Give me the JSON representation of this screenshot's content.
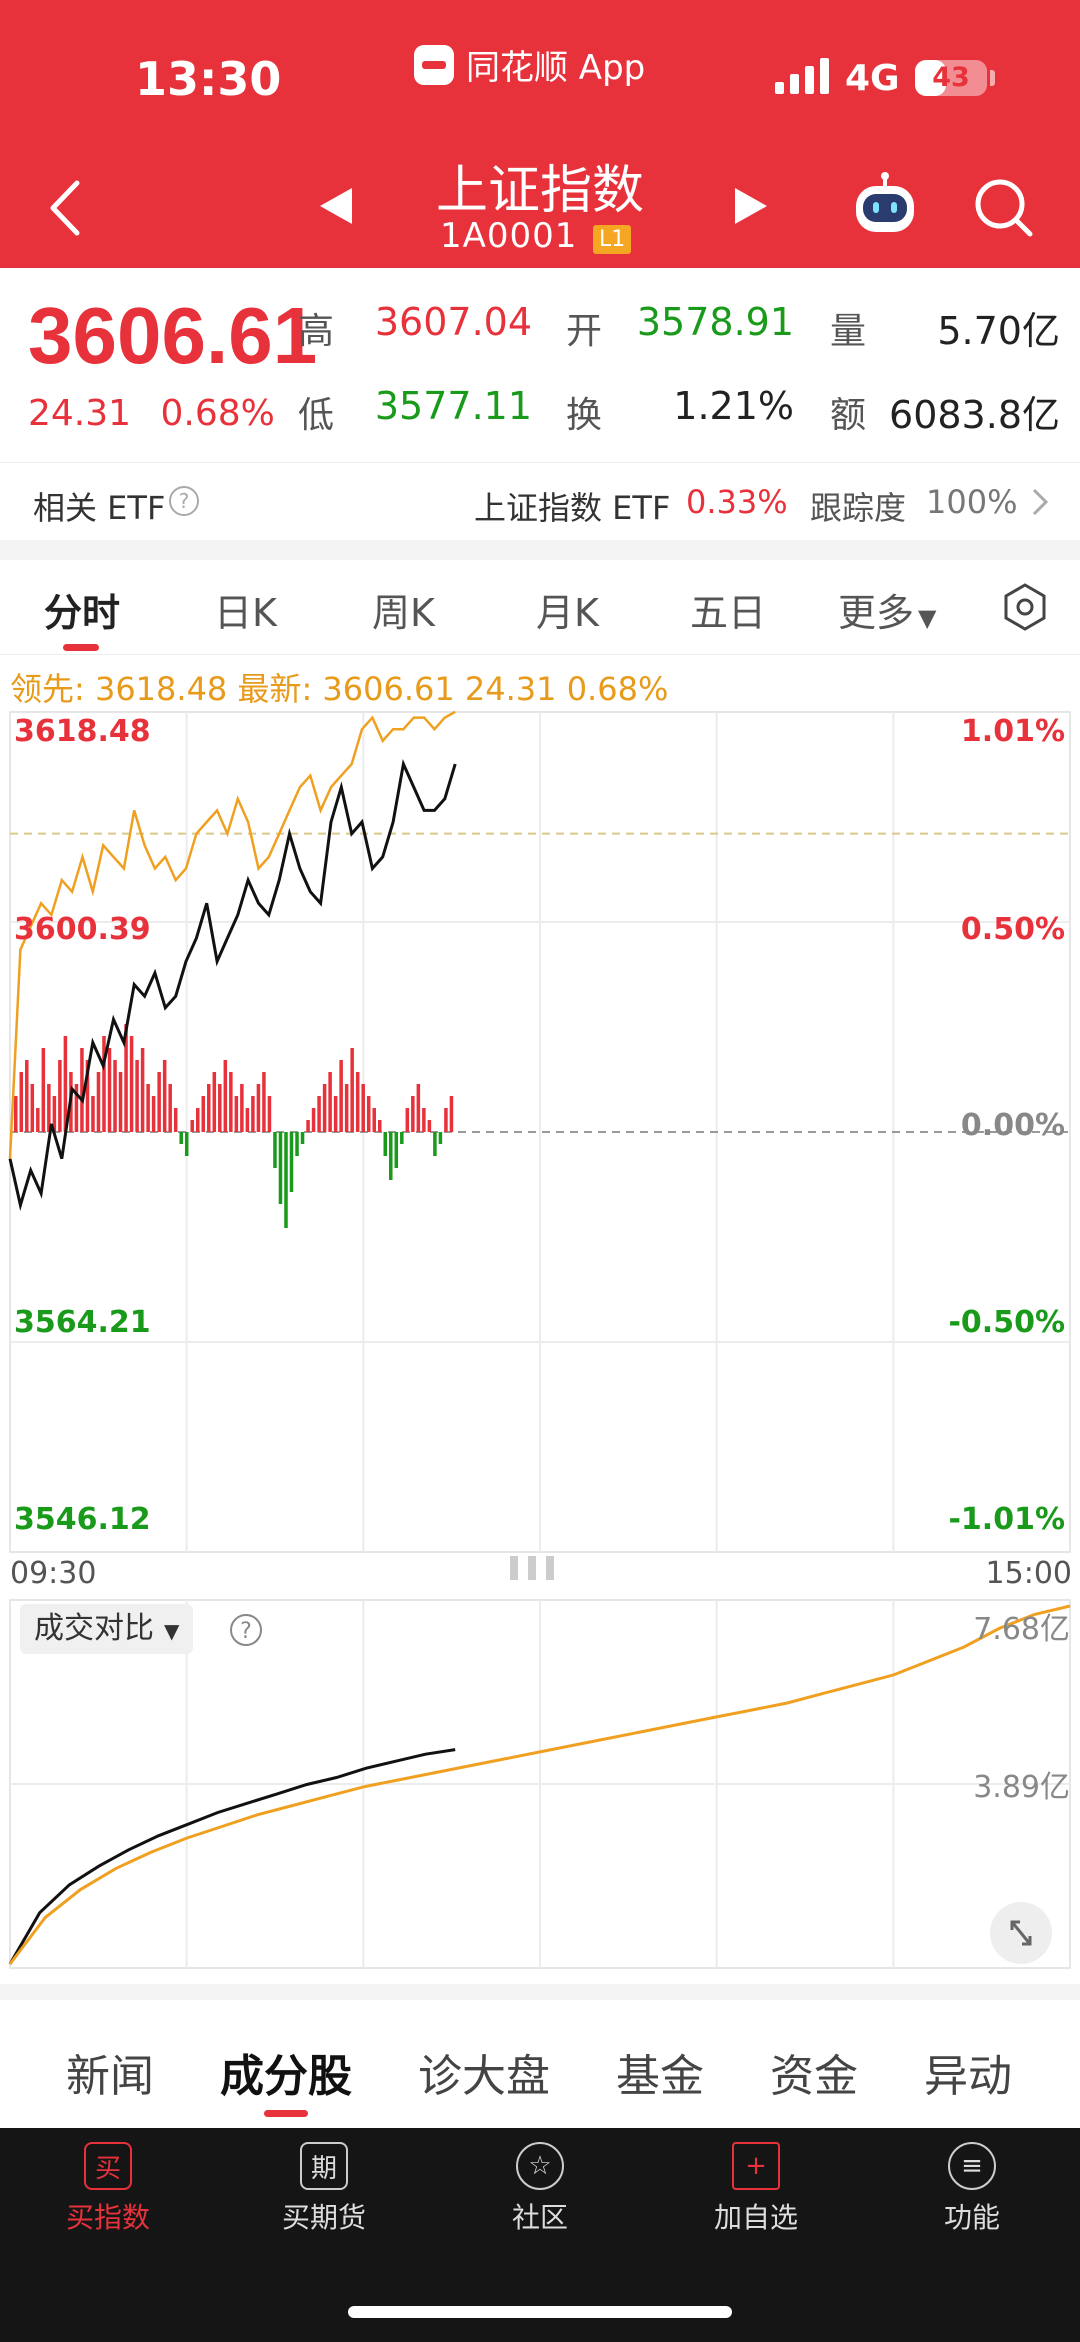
{
  "status": {
    "time": "13:30",
    "app": "同花顺 App",
    "network": "4G",
    "battery": "43",
    "battery_level": 0.43
  },
  "nav": {
    "title": "上证指数",
    "code": "1A0001",
    "tag": "L1"
  },
  "quote": {
    "price": "3606.61",
    "change": "24.31",
    "change_pct": "0.68%",
    "high_label": "高",
    "high": "3607.04",
    "open_label": "开",
    "open": "3578.91",
    "volume_label": "量",
    "volume": "5.70亿",
    "low_label": "低",
    "low": "3577.11",
    "turnover_label": "换",
    "turnover": "1.21%",
    "amount_label": "额",
    "amount": "6083.8亿"
  },
  "etf": {
    "label": "相关 ETF",
    "name": "上证指数 ETF",
    "pct": "0.33%",
    "tracking_label": "跟踪度",
    "tracking": "100%"
  },
  "chart_tabs": [
    {
      "label": "分时"
    },
    {
      "label": "日K"
    },
    {
      "label": "周K"
    },
    {
      "label": "月K"
    },
    {
      "label": "五日"
    },
    {
      "label": "更多"
    }
  ],
  "chart_info": "领先: 3618.48  最新: 3606.61  24.31  0.68%",
  "chart_data": {
    "type": "line",
    "ylim": [
      3546.12,
      3618.48
    ],
    "y_labels_left": [
      "3618.48",
      "3600.39",
      "3564.21",
      "3546.12"
    ],
    "y_labels_right": [
      "1.01%",
      "0.50%",
      "0.00%",
      "-0.50%",
      "-1.01%"
    ],
    "x_labels": [
      "09:30",
      "15:00"
    ],
    "series": [
      {
        "color": "#111111",
        "values": [
          3580,
          3576,
          3579,
          3577,
          3583,
          3580,
          3586,
          3585,
          3590,
          3588,
          3592,
          3590,
          3595,
          3594,
          3596,
          3593,
          3594,
          3597,
          3599,
          3602,
          3597,
          3599,
          3601,
          3604,
          3602,
          3601,
          3604,
          3608,
          3605,
          3603,
          3602,
          3609,
          3612,
          3608,
          3609,
          3605,
          3606,
          3609,
          3614,
          3612,
          3610,
          3610,
          3611,
          3614
        ]
      },
      {
        "color": "#f0a020",
        "values": [
          3580,
          3598,
          3600,
          3602,
          3601,
          3604,
          3603,
          3606,
          3603,
          3607,
          3606,
          3605,
          3610,
          3607,
          3605,
          3606,
          3604,
          3605,
          3608,
          3609,
          3610,
          3608,
          3611,
          3609,
          3605,
          3606,
          3608,
          3610,
          3612,
          3613,
          3610,
          3612,
          3613,
          3614,
          3617,
          3618,
          3616,
          3617,
          3617,
          3618,
          3618,
          3617,
          3618,
          3618.5
        ]
      }
    ],
    "volume_bars": [
      3,
      5,
      6,
      4,
      2,
      7,
      4,
      3,
      6,
      8,
      5,
      4,
      7,
      6,
      3,
      5,
      8,
      7,
      6,
      5,
      9,
      8,
      6,
      7,
      4,
      3,
      5,
      6,
      4,
      2,
      -1,
      -2,
      1,
      2,
      3,
      4,
      5,
      4,
      6,
      5,
      3,
      4,
      2,
      3,
      4,
      5,
      3,
      -3,
      -6,
      -8,
      -5,
      -2,
      -1,
      1,
      2,
      3,
      4,
      5,
      3,
      6,
      4,
      7,
      5,
      4,
      3,
      2,
      1,
      -2,
      -4,
      -3,
      -1,
      2,
      3,
      4,
      2,
      1,
      -2,
      -1,
      2,
      3
    ],
    "cumulative": {
      "y_labels": [
        "7.68亿",
        "3.89亿"
      ],
      "series": [
        {
          "color": "#111111",
          "values": [
            0,
            1.1,
            1.7,
            2.1,
            2.45,
            2.75,
            3.0,
            3.25,
            3.45,
            3.65,
            3.85,
            4.0,
            4.2,
            4.35,
            4.5,
            4.6
          ]
        },
        {
          "color": "#f0a020",
          "values": [
            0,
            1.0,
            1.6,
            2.05,
            2.4,
            2.7,
            2.95,
            3.2,
            3.4,
            3.6,
            3.8,
            3.95,
            4.1,
            4.25,
            4.4,
            4.55,
            4.7,
            4.85,
            5.0,
            5.15,
            5.3,
            5.45,
            5.6,
            5.8,
            6.0,
            6.2,
            6.5,
            6.8,
            7.2,
            7.5,
            7.68
          ]
        }
      ]
    }
  },
  "volume_panel": {
    "label": "成交对比"
  },
  "bottom_tabs": [
    {
      "label": "新闻"
    },
    {
      "label": "成分股"
    },
    {
      "label": "诊大盘"
    },
    {
      "label": "基金"
    },
    {
      "label": "资金"
    },
    {
      "label": "异动"
    }
  ],
  "bottom_nav": [
    {
      "label": "买指数",
      "glyph": "买"
    },
    {
      "label": "买期货",
      "glyph": "期"
    },
    {
      "label": "社区",
      "glyph": "☆"
    },
    {
      "label": "加自选",
      "glyph": "+"
    },
    {
      "label": "功能",
      "glyph": "≡"
    }
  ],
  "colors": {
    "brand": "#e8323b",
    "up": "#e8323b",
    "down": "#1a9a1a",
    "leading_line": "#f0a020"
  }
}
